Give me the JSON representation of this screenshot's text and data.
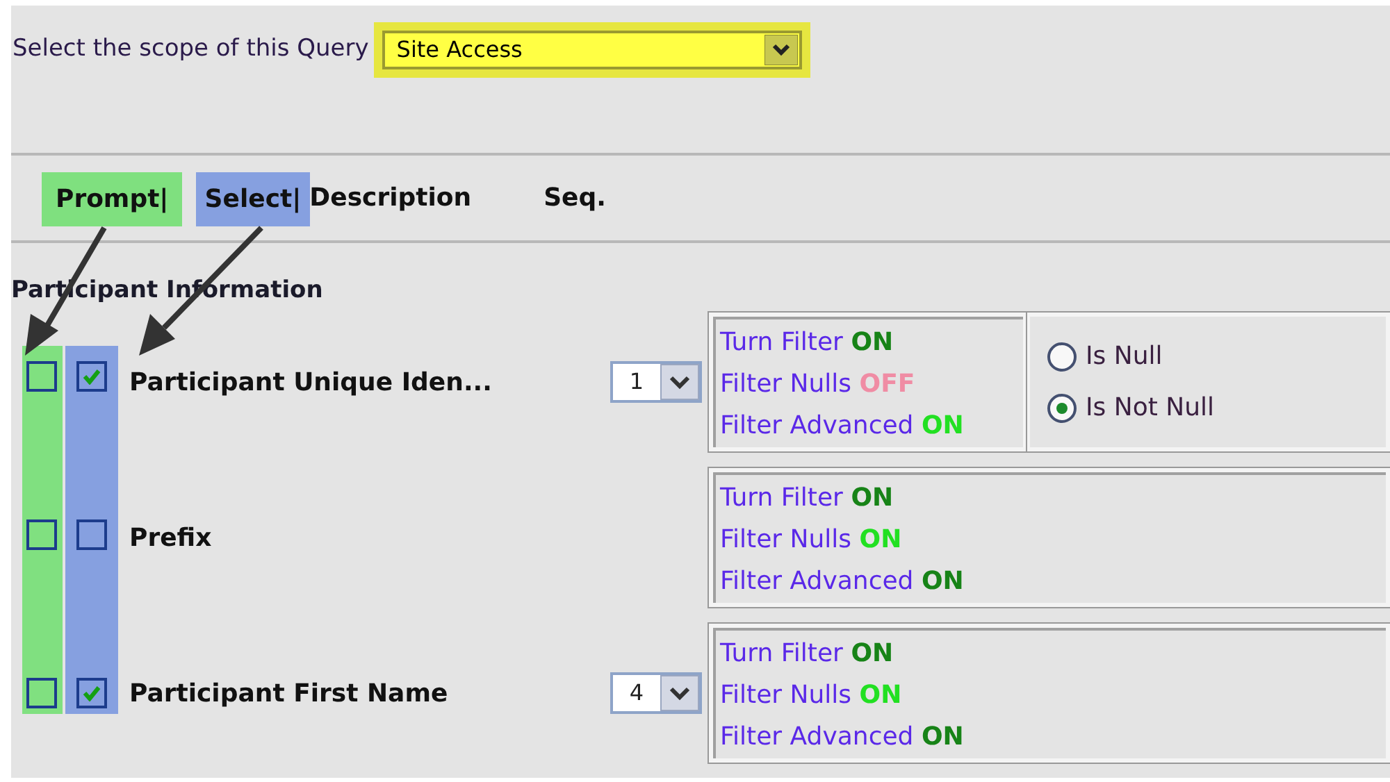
{
  "scope": {
    "label": "Select the scope of this Query",
    "value": "Site Access"
  },
  "columns": [
    {
      "label": "Prompt|",
      "kind": "prompt"
    },
    {
      "label": "Select|",
      "kind": "select"
    },
    {
      "label": "Description",
      "kind": "plain"
    },
    {
      "label": "Seq.",
      "kind": "seq"
    }
  ],
  "section": "Participant Information",
  "rows": [
    {
      "prompt": false,
      "select": true,
      "name": "Participant Unique Iden...",
      "seq": "1",
      "filters": [
        {
          "label": "Turn Filter",
          "value": "ON",
          "color": "#178317"
        },
        {
          "label": "Filter Nulls",
          "value": "OFF",
          "color": "#f08ca4"
        },
        {
          "label": "Filter Advanced",
          "value": "ON",
          "color": "#22e022"
        }
      ],
      "null_options": [
        {
          "label": "Is Null",
          "selected": false
        },
        {
          "label": "Is Not Null",
          "selected": true
        }
      ]
    },
    {
      "prompt": false,
      "select": false,
      "name": "Prefix",
      "filters": [
        {
          "label": "Turn Filter",
          "value": "ON",
          "color": "#178317"
        },
        {
          "label": "Filter Nulls",
          "value": "ON",
          "color": "#22e022"
        },
        {
          "label": "Filter Advanced",
          "value": "ON",
          "color": "#178317"
        }
      ]
    },
    {
      "prompt": false,
      "select": true,
      "name": "Participant First Name",
      "seq": "4",
      "filters": [
        {
          "label": "Turn Filter",
          "value": "ON",
          "color": "#178317"
        },
        {
          "label": "Filter Nulls",
          "value": "ON",
          "color": "#22e022"
        },
        {
          "label": "Filter Advanced",
          "value": "ON",
          "color": "#178317"
        }
      ]
    }
  ]
}
